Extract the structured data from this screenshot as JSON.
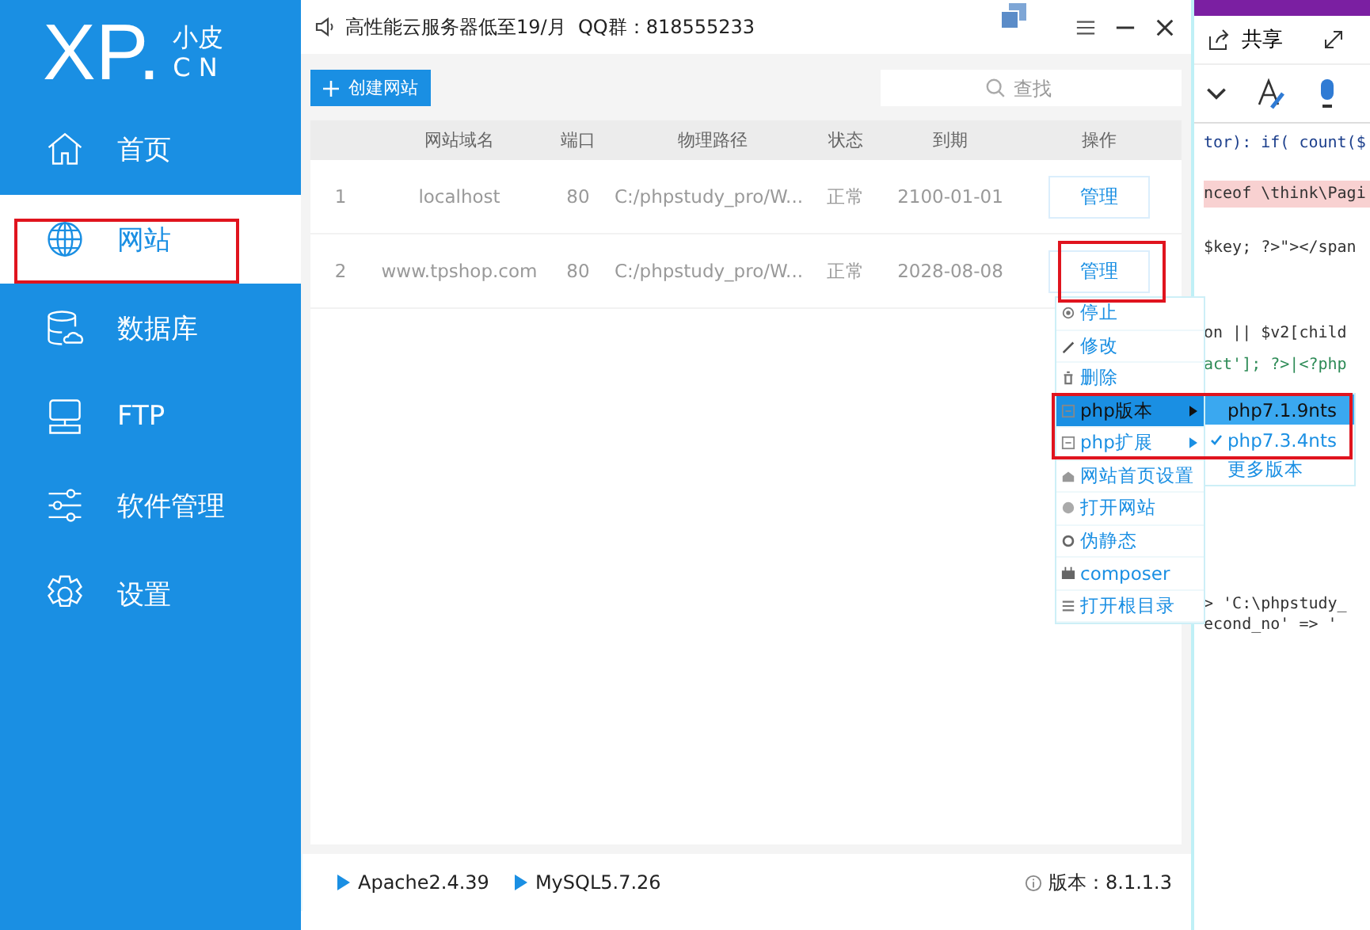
{
  "logo": {
    "mark": "XP.",
    "top": "小皮",
    "bottom": "CN"
  },
  "sidebar": {
    "items": [
      {
        "label": "首页",
        "selected": false
      },
      {
        "label": "网站",
        "selected": true
      },
      {
        "label": "数据库",
        "selected": false
      },
      {
        "label": "FTP",
        "selected": false
      },
      {
        "label": "软件管理",
        "selected": false
      },
      {
        "label": "设置",
        "selected": false
      }
    ]
  },
  "notice": "高性能云服务器低至19/月  QQ群：818555233",
  "toolbar": {
    "create_button": "创建网站",
    "search": {
      "placeholder": "查找"
    }
  },
  "table": {
    "columns": [
      "",
      "网站域名",
      "端口",
      "物理路径",
      "状态",
      "到期",
      "操作"
    ],
    "rows": [
      {
        "index": "1",
        "domain": "localhost",
        "port": "80",
        "path": "C:/phpstudy_pro/W...",
        "status": "正常",
        "expiry": "2100-01-01",
        "action": "管理"
      },
      {
        "index": "2",
        "domain": "www.tpshop.com",
        "port": "80",
        "path": "C:/phpstudy_pro/W...",
        "status": "正常",
        "expiry": "2028-08-08",
        "action": "管理"
      }
    ]
  },
  "context_menu": {
    "items": [
      {
        "label": "停止",
        "highlighted": false,
        "submenu": false
      },
      {
        "label": "修改",
        "highlighted": false,
        "submenu": false
      },
      {
        "label": "删除",
        "highlighted": false,
        "submenu": false
      },
      {
        "label": "php版本",
        "highlighted": true,
        "submenu": true
      },
      {
        "label": "php扩展",
        "highlighted": false,
        "submenu": true
      },
      {
        "label": "网站首页设置",
        "highlighted": false,
        "submenu": false
      },
      {
        "label": "打开网站",
        "highlighted": false,
        "submenu": false
      },
      {
        "label": "伪静态",
        "highlighted": false,
        "submenu": false
      },
      {
        "label": "composer",
        "highlighted": false,
        "submenu": false
      },
      {
        "label": "打开根目录",
        "highlighted": false,
        "submenu": false
      }
    ]
  },
  "php_version_menu": {
    "items": [
      {
        "label": "php7.1.9nts",
        "highlighted": true,
        "checked": false
      },
      {
        "label": "php7.3.4nts",
        "highlighted": false,
        "checked": true
      },
      {
        "label": "更多版本",
        "highlighted": false,
        "checked": false
      }
    ]
  },
  "status_bar": {
    "services": [
      "Apache2.4.39",
      "MySQL5.7.26"
    ],
    "version": "版本：8.1.1.3"
  },
  "editor": {
    "share": "共享",
    "code_lines": [
      {
        "text": "tor): if( count($",
        "highlighted": false
      },
      {
        "text": "nceof \\think\\Pagi",
        "highlighted": true
      },
      {
        "text": "$key; ?>\"></span",
        "highlighted": false
      },
      {
        "text": "on || $v2[child",
        "highlighted": false
      },
      {
        "text": "act']; ?>|<?php",
        "highlighted": false
      },
      {
        "text": "> 'C:\\phpstudy_",
        "highlighted": false
      },
      {
        "text": "econd_no' => '",
        "highlighted": false
      }
    ]
  }
}
